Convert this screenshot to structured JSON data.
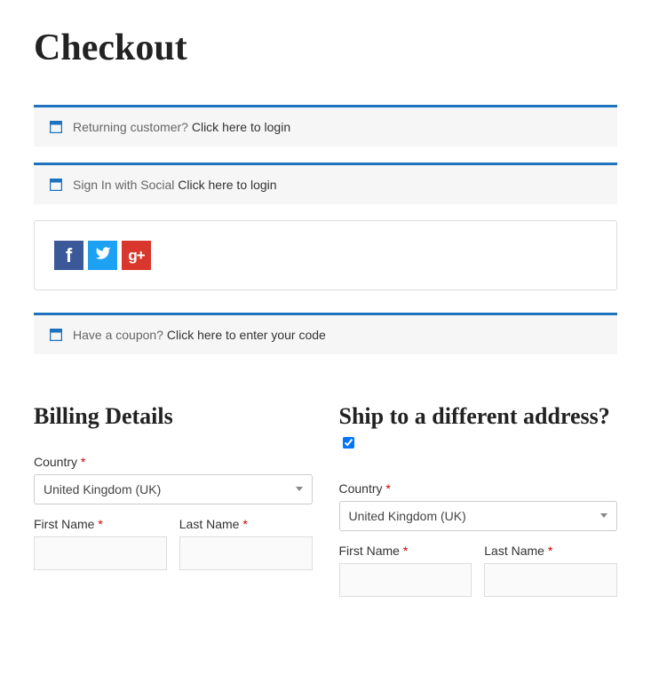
{
  "page_title": "Checkout",
  "notices": {
    "returning": {
      "text": "Returning customer?",
      "link": "Click here to login"
    },
    "social": {
      "text": "Sign In with Social",
      "link": "Click here to login"
    },
    "coupon": {
      "text": "Have a coupon?",
      "link": "Click here to enter your code"
    }
  },
  "social_buttons": {
    "facebook": "f",
    "twitter_icon": "twitter",
    "google_plus": "g+"
  },
  "billing": {
    "heading": "Billing Details",
    "country_label": "Country",
    "country_value": "United Kingdom (UK)",
    "first_name_label": "First Name",
    "last_name_label": "Last Name"
  },
  "shipping": {
    "heading": "Ship to a different ad­dress?",
    "checked": true,
    "country_label": "Country",
    "country_value": "United Kingdom (UK)",
    "first_name_label": "First Name",
    "last_name_label": "Last Name"
  },
  "required_mark": "*"
}
